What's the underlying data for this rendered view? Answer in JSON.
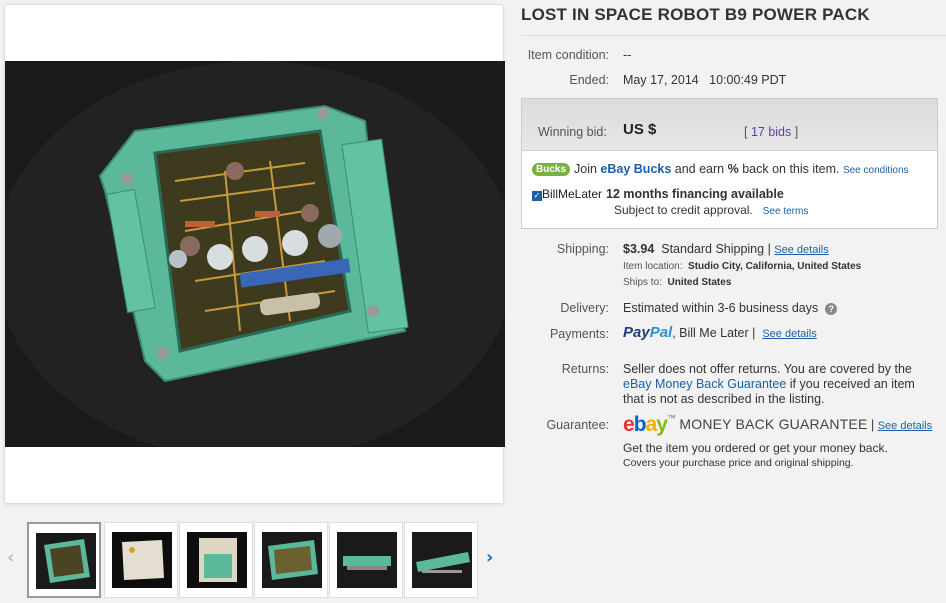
{
  "title": "LOST IN SPACE ROBOT B9 POWER PACK",
  "condition": {
    "label": "Item condition:",
    "value": "--"
  },
  "ended": {
    "label": "Ended:",
    "date": "May 17, 2014",
    "time": "10:00:49 PDT"
  },
  "bid": {
    "label": "Winning bid:",
    "value": "US $",
    "bids_open": "[ ",
    "bids_link": "17 bids",
    "bids_close": " ]"
  },
  "bucks": {
    "logo": "Bucks",
    "text1": "Join ",
    "link": "eBay Bucks",
    "text2": " and earn ",
    "pct": "%",
    "text3": " back on this item. ",
    "conditions": "See conditions"
  },
  "billmelater": {
    "logo": "BillMeLater",
    "headline": "12 months financing available",
    "sub": "Subject to credit approval.",
    "terms": "See terms"
  },
  "shipping": {
    "label": "Shipping:",
    "price": "$3.94",
    "method": "Standard Shipping",
    "sep": " | ",
    "details": "See details",
    "location_label": "Item location:",
    "location": "Studio City, California, United States",
    "ships_label": "Ships to:",
    "ships_to": "United States"
  },
  "delivery": {
    "label": "Delivery:",
    "value": "Estimated within 3-6 business days",
    "help_icon": "?"
  },
  "payments": {
    "label": "Payments:",
    "paypal_1": "Pay",
    "paypal_2": "Pal",
    "rest": ", Bill Me Later",
    "sep": " | ",
    "details": "See details"
  },
  "returns": {
    "label": "Returns:",
    "line1": "Seller does not offer returns. You are covered by the",
    "link": "eBay Money Back Guarantee",
    "line2": " if you received an item",
    "line3": "that is not as described in the listing."
  },
  "guarantee": {
    "label": "Guarantee:",
    "mbg": "MONEY BACK GUARANTEE",
    "sep": " | ",
    "details": "See details",
    "line1": "Get the item you ordered or get your money back.",
    "line2": "Covers your purchase price and original shipping."
  },
  "gallery": {
    "prev": "‹",
    "next": "›",
    "thumbs": [
      {
        "name": "thumb-1",
        "selected": true
      },
      {
        "name": "thumb-2",
        "selected": false
      },
      {
        "name": "thumb-3",
        "selected": false
      },
      {
        "name": "thumb-4",
        "selected": false
      },
      {
        "name": "thumb-5",
        "selected": false
      },
      {
        "name": "thumb-6",
        "selected": false
      }
    ]
  },
  "colors": {
    "link": "#1e5ea8",
    "bucks": "#7ab03f",
    "ebay_e": "#e53238",
    "ebay_b": "#0064d2",
    "ebay_a": "#f5af02",
    "ebay_y": "#86b817"
  }
}
